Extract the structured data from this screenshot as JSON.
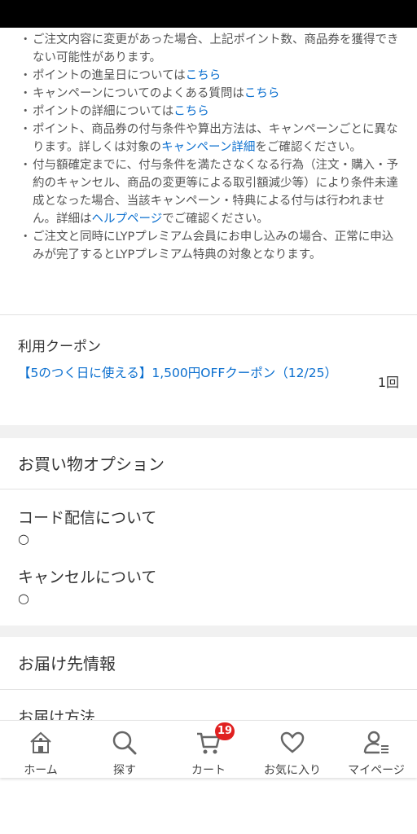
{
  "notes": [
    {
      "text": "ご注文内容に変更があった場合、上記ポイント数、商品券を獲得できない可能性があります。",
      "link": "",
      "after": ""
    },
    {
      "text": "ポイントの進呈日については",
      "link": "こちら",
      "after": ""
    },
    {
      "text": "キャンペーンについてのよくある質問は",
      "link": "こちら",
      "after": ""
    },
    {
      "text": "ポイントの詳細については",
      "link": "こちら",
      "after": ""
    },
    {
      "text": "ポイント、商品券の付与条件や算出方法は、キャンペーンごとに異なります。詳しくは対象の",
      "link": "キャンペーン詳細",
      "after": "をご確認ください。"
    },
    {
      "text": "付与額確定までに、付与条件を満たさなくなる行為（注文・購入・予約のキャンセル、商品の変更等による取引額減少等）により条件未達成となった場合、当該キャンペーン・特典による付与は行われません。詳細は",
      "link": "ヘルプページ",
      "after": "でご確認ください。"
    },
    {
      "text": "ご注文と同時にLYPプレミアム会員にお申し込みの場合、正常に申込みが完了するとLYPプレミアム特典の対象となります。",
      "link": "",
      "after": ""
    }
  ],
  "coupon": {
    "label": "利用クーポン",
    "name": "【5のつく日に使える】1,500円OFFクーポン（12/25）",
    "count": "1回"
  },
  "options": {
    "title": "お買い物オプション",
    "items": [
      {
        "label": "コード配信について",
        "value": "○"
      },
      {
        "label": "キャンセルについて",
        "value": "○"
      }
    ]
  },
  "delivery": {
    "title": "お届け先情報",
    "method_label": "お届け方法"
  },
  "tabbar": {
    "items": [
      {
        "label": "ホーム",
        "icon": "home-icon"
      },
      {
        "label": "探す",
        "icon": "search-icon"
      },
      {
        "label": "カート",
        "icon": "cart-icon",
        "badge": "19"
      },
      {
        "label": "お気に入り",
        "icon": "heart-icon"
      },
      {
        "label": "マイページ",
        "icon": "user-icon"
      }
    ]
  },
  "colors": {
    "link": "#0b6fcf",
    "badge": "#e02020",
    "band": "#f1f1f1"
  }
}
